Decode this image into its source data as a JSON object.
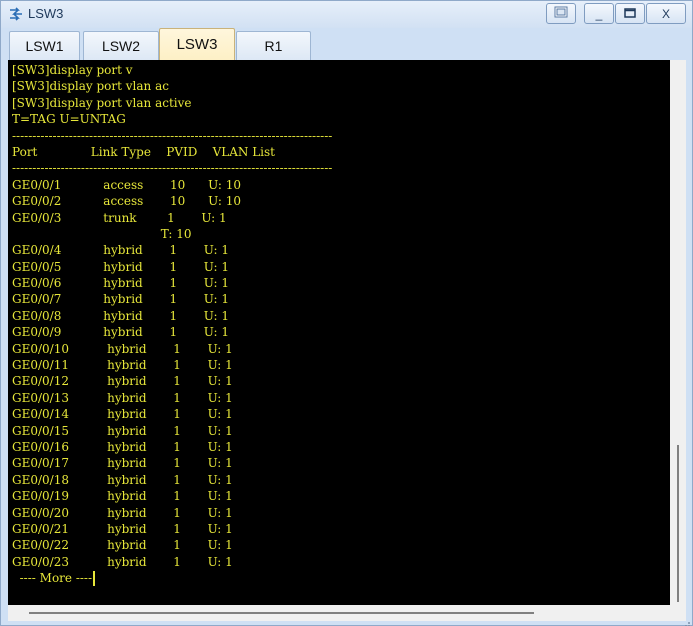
{
  "window": {
    "title": "LSW3",
    "icon": "switch-icon",
    "controls": {
      "restore": "restore-icon",
      "minimize_label": "_",
      "maximize": "maximize-icon",
      "close_label": "X"
    }
  },
  "tabs": [
    {
      "label": "LSW1",
      "active": false
    },
    {
      "label": "LSW2",
      "active": false
    },
    {
      "label": "LSW3",
      "active": true
    },
    {
      "label": "R1",
      "active": false
    }
  ],
  "terminal": {
    "text_color": "#e7e73a",
    "background": "#000000",
    "lines": [
      "[SW3]display port v",
      "[SW3]display port vlan ac",
      "[SW3]display port vlan active",
      "T=TAG U=UNTAG",
      "-------------------------------------------------------------------------------",
      "Port              Link Type    PVID    VLAN List",
      "-------------------------------------------------------------------------------",
      "GE0/0/1           access       10      U: 10",
      "GE0/0/2           access       10      U: 10",
      "GE0/0/3           trunk        1       U: 1",
      "                                       T: 10",
      "GE0/0/4           hybrid       1       U: 1",
      "GE0/0/5           hybrid       1       U: 1",
      "GE0/0/6           hybrid       1       U: 1",
      "GE0/0/7           hybrid       1       U: 1",
      "GE0/0/8           hybrid       1       U: 1",
      "GE0/0/9           hybrid       1       U: 1",
      "GE0/0/10          hybrid       1       U: 1",
      "GE0/0/11          hybrid       1       U: 1",
      "GE0/0/12          hybrid       1       U: 1",
      "GE0/0/13          hybrid       1       U: 1",
      "GE0/0/14          hybrid       1       U: 1",
      "GE0/0/15          hybrid       1       U: 1",
      "GE0/0/16          hybrid       1       U: 1",
      "GE0/0/17          hybrid       1       U: 1",
      "GE0/0/18          hybrid       1       U: 1",
      "GE0/0/19          hybrid       1       U: 1",
      "GE0/0/20          hybrid       1       U: 1",
      "GE0/0/21          hybrid       1       U: 1",
      "GE0/0/22          hybrid       1       U: 1",
      "GE0/0/23          hybrid       1       U: 1"
    ],
    "more_prompt": "  ---- More ----"
  }
}
